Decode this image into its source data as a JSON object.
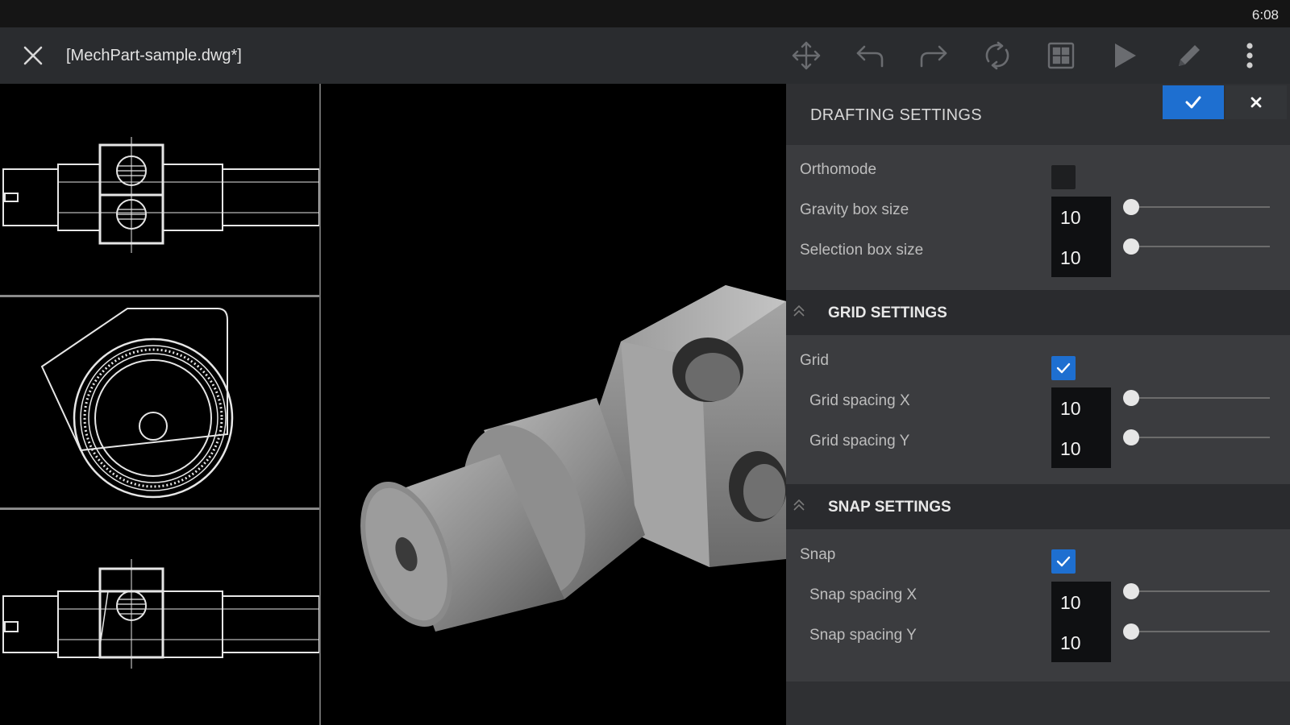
{
  "status_bar": {
    "time": "6:08"
  },
  "toolbar": {
    "file_name": "[MechPart-sample.dwg*]",
    "icons": [
      "close-icon",
      "move-icon",
      "undo-icon",
      "redo-icon",
      "rotate-icon",
      "grid-view-icon",
      "play-icon",
      "pencil-icon",
      "more-vert-icon"
    ]
  },
  "drafting_panel": {
    "title": "DRAFTING SETTINGS",
    "accent_color": "#1e6fd0",
    "orthomode": {
      "label": "Orthomode",
      "checked": false
    },
    "gravity_box": {
      "label": "Gravity box size",
      "value": "10",
      "slider_fraction": 0
    },
    "selection_box": {
      "label": "Selection box size",
      "value": "10",
      "slider_fraction": 0
    },
    "grid_settings": {
      "title": "GRID SETTINGS",
      "grid": {
        "label": "Grid",
        "checked": true
      },
      "spacing_x": {
        "label": "Grid spacing X",
        "value": "10",
        "slider_fraction": 0
      },
      "spacing_y": {
        "label": "Grid spacing Y",
        "value": "10",
        "slider_fraction": 0
      }
    },
    "snap_settings": {
      "title": "SNAP SETTINGS",
      "snap": {
        "label": "Snap",
        "checked": true
      },
      "spacing_x": {
        "label": "Snap spacing X",
        "value": "10",
        "slider_fraction": 0
      },
      "spacing_y": {
        "label": "Snap spacing Y",
        "value": "10",
        "slider_fraction": 0
      }
    }
  }
}
